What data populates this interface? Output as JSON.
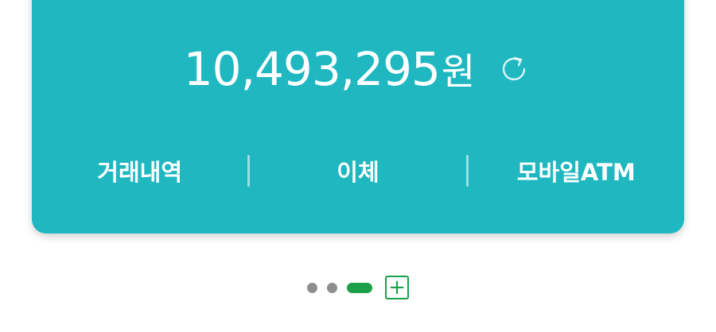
{
  "account": {
    "balance_amount": "10,493,295",
    "balance_unit": "원"
  },
  "actions": [
    {
      "label": "거래내역"
    },
    {
      "label": "이체"
    },
    {
      "label": "모바일ATM"
    }
  ],
  "pager": {
    "add_symbol": "+"
  },
  "colors": {
    "card_bg": "#1fb8c1",
    "accent_green": "#1c9f49",
    "dot_inactive": "#8e8e8e"
  },
  "icons": {
    "refresh": "refresh-icon",
    "add": "plus-icon"
  }
}
